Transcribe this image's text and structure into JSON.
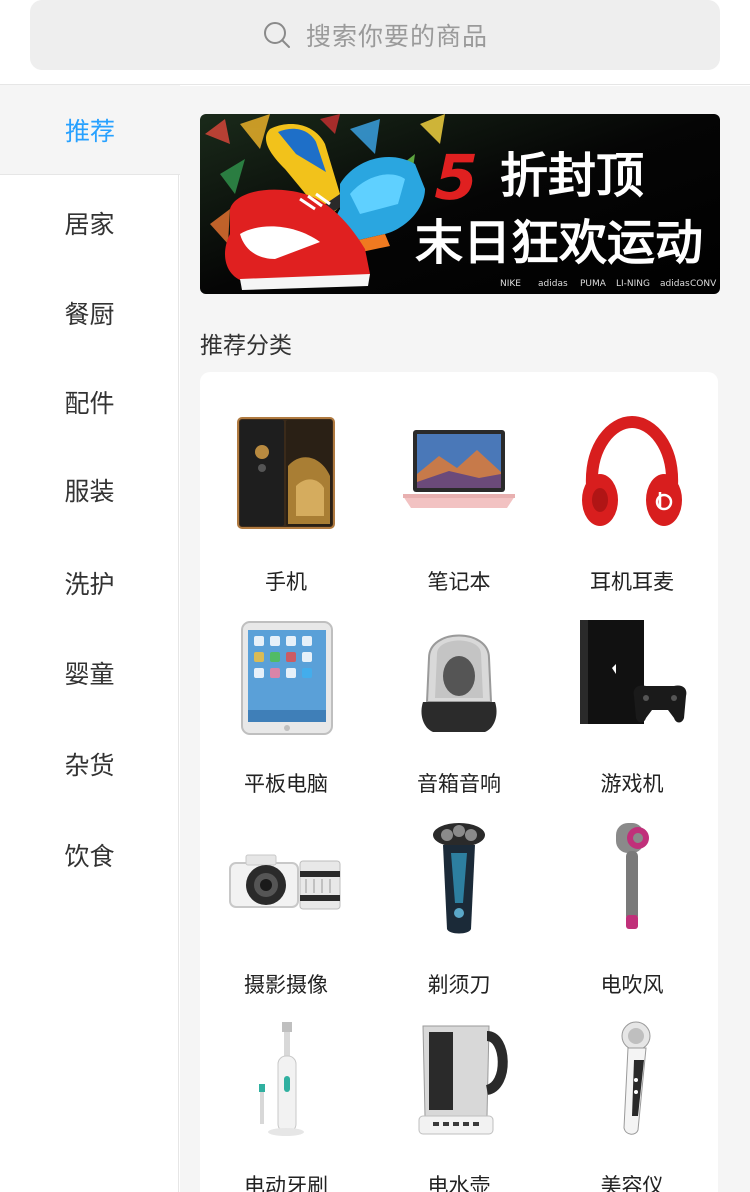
{
  "search": {
    "placeholder": "搜索你要的商品"
  },
  "sidebar": {
    "items": [
      {
        "label": "推荐",
        "active": true
      },
      {
        "label": "居家"
      },
      {
        "label": "餐厨"
      },
      {
        "label": "配件"
      },
      {
        "label": "服装"
      },
      {
        "label": "洗护"
      },
      {
        "label": "婴童"
      },
      {
        "label": "杂货"
      },
      {
        "label": "饮食"
      }
    ]
  },
  "banner": {
    "headline_top": "5折封顶",
    "headline_bottom": "末日狂欢运动",
    "brands": [
      "NIKE",
      "adidas",
      "PUMA",
      "LI-NING",
      "Converse"
    ]
  },
  "main": {
    "section_title": "推荐分类",
    "categories": [
      {
        "label": "手机",
        "icon": "phone"
      },
      {
        "label": "笔记本",
        "icon": "laptop"
      },
      {
        "label": "耳机耳麦",
        "icon": "headphones"
      },
      {
        "label": "平板电脑",
        "icon": "tablet"
      },
      {
        "label": "音箱音响",
        "icon": "speaker"
      },
      {
        "label": "游戏机",
        "icon": "game-console"
      },
      {
        "label": "摄影摄像",
        "icon": "camera"
      },
      {
        "label": "剃须刀",
        "icon": "shaver"
      },
      {
        "label": "电吹风",
        "icon": "hair-dryer"
      },
      {
        "label": "电动牙刷",
        "icon": "electric-toothbrush"
      },
      {
        "label": "电水壶",
        "icon": "kettle"
      },
      {
        "label": "美容仪",
        "icon": "beauty-device"
      }
    ]
  },
  "colors": {
    "accent": "#27a1ff",
    "bg": "#f5f5f5",
    "banner_red": "#e02020"
  }
}
